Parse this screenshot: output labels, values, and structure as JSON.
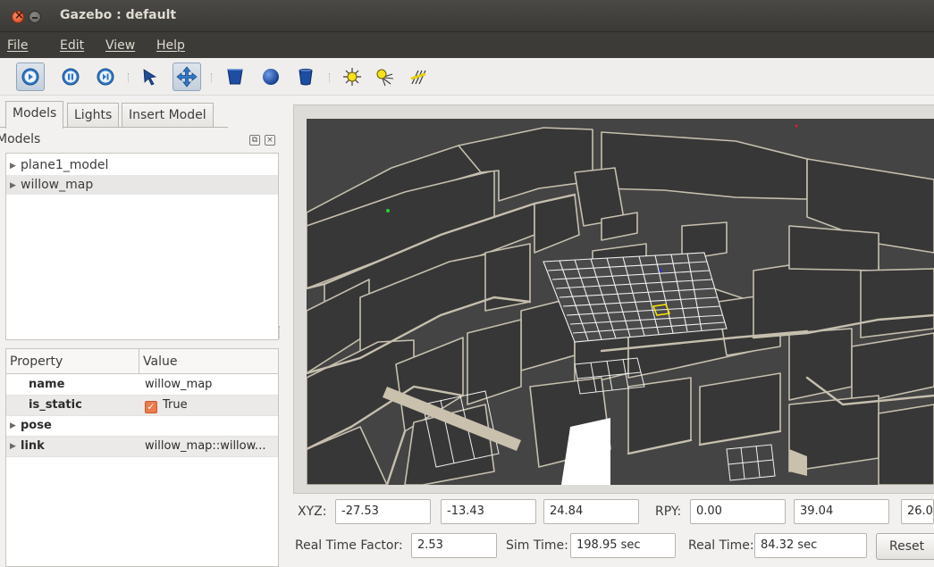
{
  "window": {
    "title": "Gazebo : default"
  },
  "menu": [
    "File",
    "Edit",
    "View",
    "Help"
  ],
  "toolbar": {
    "buttons": [
      "play",
      "pause",
      "step",
      "select",
      "translate",
      "box",
      "sphere",
      "cylinder",
      "point-light",
      "spot-light",
      "directional-light"
    ],
    "active_play": true,
    "active_tool": "translate"
  },
  "left": {
    "tabs": [
      "Models",
      "Lights",
      "Insert Model"
    ],
    "models_label": "Models",
    "tree": [
      "plane1_model",
      "willow_map"
    ],
    "props_header": {
      "property": "Property",
      "value": "Value"
    },
    "props": [
      {
        "key": "name",
        "value": "willow_map"
      },
      {
        "key": "is_static",
        "value": "True"
      },
      {
        "key": "pose",
        "value": ""
      },
      {
        "key": "link",
        "value": "willow_map::willow..."
      }
    ]
  },
  "pose": {
    "xyz_label": "XYZ:",
    "x": "-27.53",
    "y": "-13.43",
    "z": "24.84",
    "rpy_label": "RPY:",
    "roll": "0.00",
    "pitch": "39.04",
    "yaw": "26.0"
  },
  "status": {
    "rtf_label": "Real Time Factor:",
    "rtf": "2.53",
    "sim_label": "Sim Time:",
    "sim": "198.95 sec",
    "real_label": "Real Time:",
    "real": "84.32 sec",
    "reset_label": "Reset"
  },
  "colors": {
    "titlebar": "#3c3b37",
    "accent": "#ee7a4e",
    "viewport": "#404040",
    "walls": "#373737",
    "wall_tops": "#c6bfae"
  }
}
